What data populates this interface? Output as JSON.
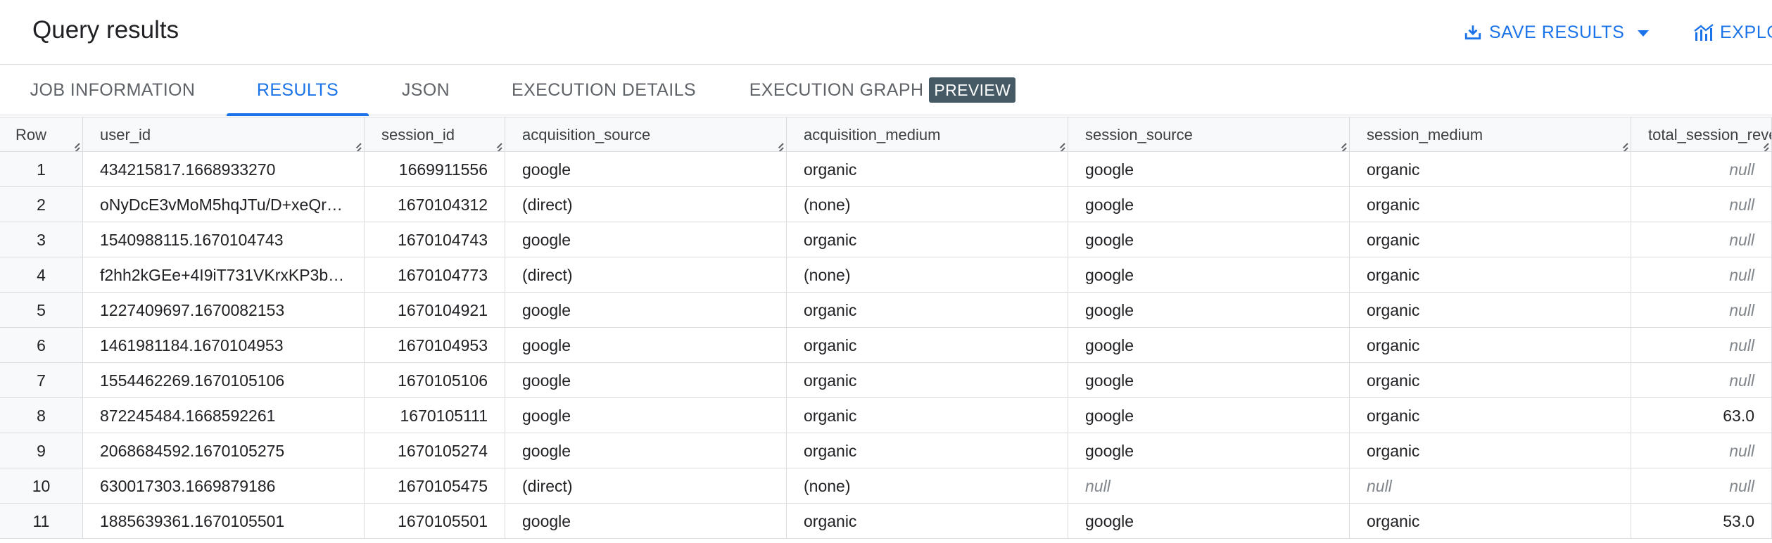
{
  "header": {
    "title": "Query results",
    "save_results_label": "SAVE RESULTS",
    "explore_label": "EXPLORE DATA",
    "accent_color": "#1a73e8"
  },
  "tabs": [
    {
      "label": "JOB INFORMATION",
      "active": false
    },
    {
      "label": "RESULTS",
      "active": true
    },
    {
      "label": "JSON",
      "active": false
    },
    {
      "label": "EXECUTION DETAILS",
      "active": false
    },
    {
      "label": "EXECUTION GRAPH",
      "active": false,
      "badge": "PREVIEW"
    }
  ],
  "table": {
    "columns": [
      "Row",
      "user_id",
      "session_id",
      "acquisition_source",
      "acquisition_medium",
      "session_source",
      "session_medium",
      "total_session_revenue"
    ],
    "rows": [
      [
        "1",
        "434215817.1668933270",
        "1669911556",
        "google",
        "organic",
        "google",
        "organic",
        "null"
      ],
      [
        "2",
        "oNyDcE3vMoM5hqJTu/D+xeQr…",
        "1670104312",
        "(direct)",
        "(none)",
        "google",
        "organic",
        "null"
      ],
      [
        "3",
        "1540988115.1670104743",
        "1670104743",
        "google",
        "organic",
        "google",
        "organic",
        "null"
      ],
      [
        "4",
        "f2hh2kGEe+4I9iT731VKrxKP3b…",
        "1670104773",
        "(direct)",
        "(none)",
        "google",
        "organic",
        "null"
      ],
      [
        "5",
        "1227409697.1670082153",
        "1670104921",
        "google",
        "organic",
        "google",
        "organic",
        "null"
      ],
      [
        "6",
        "1461981184.1670104953",
        "1670104953",
        "google",
        "organic",
        "google",
        "organic",
        "null"
      ],
      [
        "7",
        "1554462269.1670105106",
        "1670105106",
        "google",
        "organic",
        "google",
        "organic",
        "null"
      ],
      [
        "8",
        "872245484.1668592261",
        "1670105111",
        "google",
        "organic",
        "google",
        "organic",
        "63.0"
      ],
      [
        "9",
        "2068684592.1670105275",
        "1670105274",
        "google",
        "organic",
        "google",
        "organic",
        "null"
      ],
      [
        "10",
        "630017303.1669879186",
        "1670105475",
        "(direct)",
        "(none)",
        "null",
        "null",
        "null"
      ],
      [
        "11",
        "1885639361.1670105501",
        "1670105501",
        "google",
        "organic",
        "google",
        "organic",
        "53.0"
      ]
    ]
  }
}
